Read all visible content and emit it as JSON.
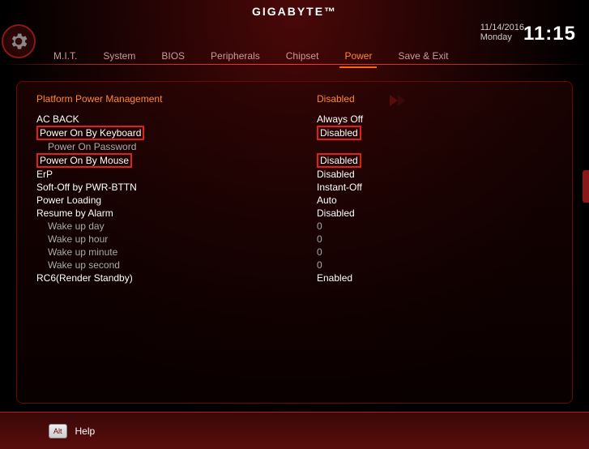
{
  "brand": "GIGABYTE™",
  "date": "11/14/2016",
  "day": "Monday",
  "time": "11:15",
  "tabs": [
    "M.I.T.",
    "System",
    "BIOS",
    "Peripherals",
    "Chipset",
    "Power",
    "Save & Exit"
  ],
  "active_tab_index": 5,
  "section": {
    "title": "Platform Power Management",
    "value": "Disabled"
  },
  "rows": [
    {
      "label": "AC BACK",
      "value": "Always Off",
      "indent": false,
      "hl_label": false,
      "hl_value": false
    },
    {
      "label": "Power On By Keyboard",
      "value": "Disabled",
      "indent": false,
      "hl_label": true,
      "hl_value": true
    },
    {
      "label": "Power On Password",
      "value": "",
      "indent": true,
      "hl_label": false,
      "hl_value": false
    },
    {
      "label": "Power On By Mouse",
      "value": "Disabled",
      "indent": false,
      "hl_label": true,
      "hl_value": true
    },
    {
      "label": "ErP",
      "value": "Disabled",
      "indent": false,
      "hl_label": false,
      "hl_value": false
    },
    {
      "label": "Soft-Off by PWR-BTTN",
      "value": "Instant-Off",
      "indent": false,
      "hl_label": false,
      "hl_value": false
    },
    {
      "label": "Power Loading",
      "value": "Auto",
      "indent": false,
      "hl_label": false,
      "hl_value": false
    },
    {
      "label": "Resume by Alarm",
      "value": "Disabled",
      "indent": false,
      "hl_label": false,
      "hl_value": false
    },
    {
      "label": "Wake up day",
      "value": "0",
      "indent": true,
      "hl_label": false,
      "hl_value": false
    },
    {
      "label": "Wake up hour",
      "value": "0",
      "indent": true,
      "hl_label": false,
      "hl_value": false
    },
    {
      "label": "Wake up minute",
      "value": "0",
      "indent": true,
      "hl_label": false,
      "hl_value": false
    },
    {
      "label": "Wake up second",
      "value": "0",
      "indent": true,
      "hl_label": false,
      "hl_value": false
    },
    {
      "label": "RC6(Render Standby)",
      "value": "Enabled",
      "indent": false,
      "hl_label": false,
      "hl_value": false
    }
  ],
  "footer": {
    "key": "Alt",
    "help": "Help"
  }
}
